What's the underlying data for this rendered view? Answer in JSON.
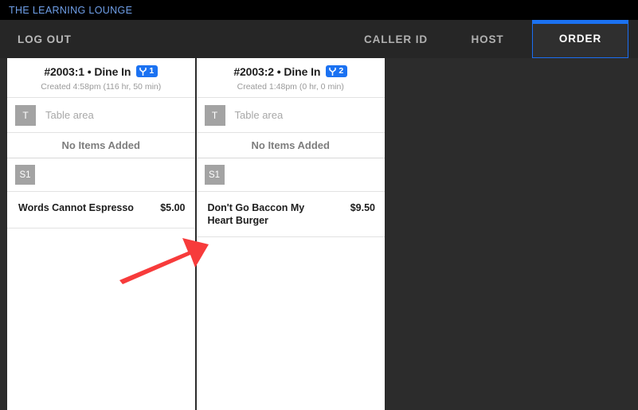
{
  "titlebar": {
    "app_name": "THE LEARNING LOUNGE"
  },
  "toolbar": {
    "logout_label": "LOG OUT",
    "tabs": [
      {
        "label": "CALLER ID",
        "active": false
      },
      {
        "label": "HOST",
        "active": false
      },
      {
        "label": "ORDER",
        "active": true
      }
    ],
    "active_tab_accent": "#1b72f2"
  },
  "orders": [
    {
      "title": "#2003:1 • Dine In",
      "guest_icon": "guest-split-icon",
      "guest_count": "1",
      "created": "Created 4:58pm (116 hr, 50 min)",
      "table_chip": "T",
      "table_placeholder": "Table area",
      "no_items_label": "No Items Added",
      "seat_chip": "S1",
      "items": [
        {
          "name": "Words Cannot Espresso",
          "price": "$5.00"
        }
      ]
    },
    {
      "title": "#2003:2 • Dine In",
      "guest_icon": "guest-split-icon",
      "guest_count": "2",
      "created": "Created 1:48pm (0 hr, 0 min)",
      "table_chip": "T",
      "table_placeholder": "Table area",
      "no_items_label": "No Items Added",
      "seat_chip": "S1",
      "items": [
        {
          "name": "Don't Go Baccon My Heart Burger",
          "price": "$9.50"
        }
      ]
    }
  ],
  "annotation": {
    "type": "arrow",
    "color": "#f73b3b",
    "points_to": "second-order-item-row"
  }
}
